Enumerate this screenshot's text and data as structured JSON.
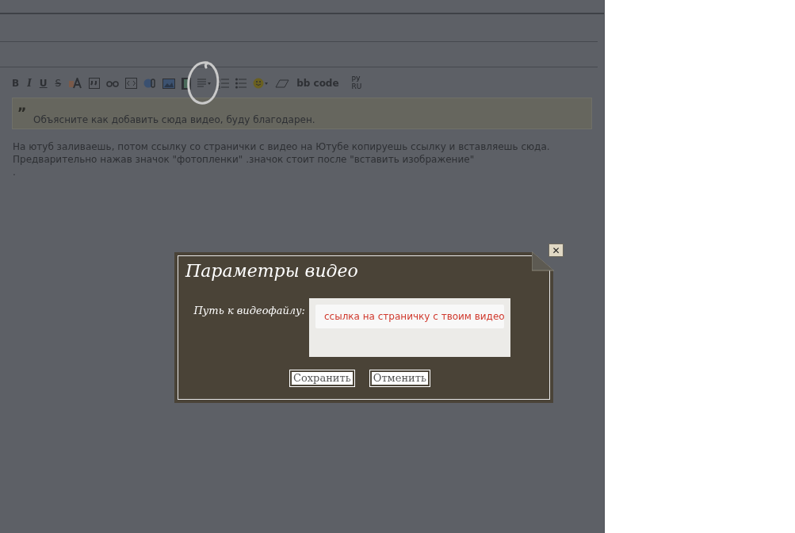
{
  "toolbar": [
    {
      "kind": "text",
      "label": "B"
    },
    {
      "kind": "text",
      "label": "I"
    },
    {
      "kind": "text",
      "label": "U"
    },
    {
      "kind": "text",
      "label": "S"
    },
    {
      "kind": "icon"
    },
    {
      "kind": "icon"
    },
    {
      "kind": "icon"
    },
    {
      "kind": "icon"
    },
    {
      "kind": "icon"
    },
    {
      "kind": "icon"
    },
    {
      "kind": "icon"
    },
    {
      "kind": "icon"
    },
    {
      "kind": "icon"
    },
    {
      "kind": "icon"
    },
    {
      "kind": "icon"
    },
    {
      "kind": "icon"
    },
    {
      "kind": "text",
      "label": "bb code"
    },
    {
      "kind": "text",
      "label": "РУ RU"
    }
  ],
  "quote": {
    "mark": "„",
    "text": "Объясните как добавить сюда видео, буду благодарен."
  },
  "message": {
    "lines": [
      "На ютуб заливаешь, потом ссылку со странички с видео на Ютубе копируешь ссылку и вставляешь сюда.",
      "Предварительно нажав значок \"фотопленки\" .значок стоит после \"вставить изображение\"",
      "."
    ]
  },
  "dialog": {
    "close": "✕",
    "title": "Параметры видео",
    "field_label": "Путь к видеофайлу:",
    "field_note": "ссылка на страничку с твоим видео",
    "buttons": [
      "Сохранить",
      "Отменить"
    ]
  }
}
